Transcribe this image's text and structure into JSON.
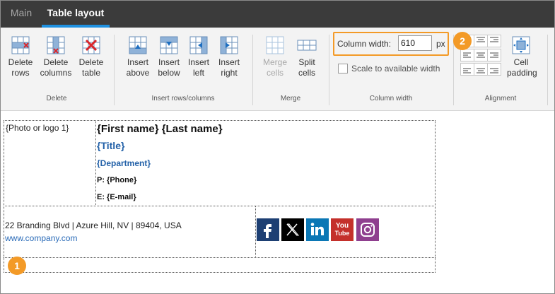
{
  "tabs": [
    {
      "label": "Main",
      "active": false
    },
    {
      "label": "Table layout",
      "active": true
    }
  ],
  "ribbon": {
    "delete": {
      "group_label": "Delete",
      "rows": "Delete\nrows",
      "rows_l1": "Delete",
      "rows_l2": "rows",
      "cols_l1": "Delete",
      "cols_l2": "columns",
      "table_l1": "Delete",
      "table_l2": "table"
    },
    "insert": {
      "group_label": "Insert rows/columns",
      "above_l1": "Insert",
      "above_l2": "above",
      "below_l1": "Insert",
      "below_l2": "below",
      "left_l1": "Insert",
      "left_l2": "left",
      "right_l1": "Insert",
      "right_l2": "right"
    },
    "merge": {
      "group_label": "Merge",
      "merge_l1": "Merge",
      "merge_l2": "cells",
      "split_l1": "Split",
      "split_l2": "cells"
    },
    "column_width": {
      "group_label": "Column width",
      "label": "Column width:",
      "value": "610",
      "unit": "px",
      "scale_label": "Scale to available width",
      "scale_checked": false
    },
    "alignment": {
      "group_label": "Alignment",
      "padding_l1": "Cell",
      "padding_l2": "padding"
    }
  },
  "badges": {
    "one": "1",
    "two": "2"
  },
  "signature": {
    "photo": "{Photo or logo 1}",
    "name": "{First name} {Last name}",
    "title": "{Title}",
    "department": "{Department}",
    "phone": "P: {Phone}",
    "email": "E: {E-mail}",
    "address": "22 Branding Blvd | Azure Hill, NV | 89404, USA",
    "website": "www.company.com"
  },
  "social": [
    {
      "name": "facebook",
      "color": "#1d3f73"
    },
    {
      "name": "x",
      "color": "#000000"
    },
    {
      "name": "linkedin",
      "color": "#0b77b5"
    },
    {
      "name": "youtube",
      "color": "#c4302b",
      "text1": "You",
      "text2": "Tube"
    },
    {
      "name": "instagram",
      "color": "#8f3f8f"
    }
  ],
  "colors": {
    "accent": "#1e90e0",
    "highlight": "#f39a27",
    "link": "#2361a8"
  }
}
